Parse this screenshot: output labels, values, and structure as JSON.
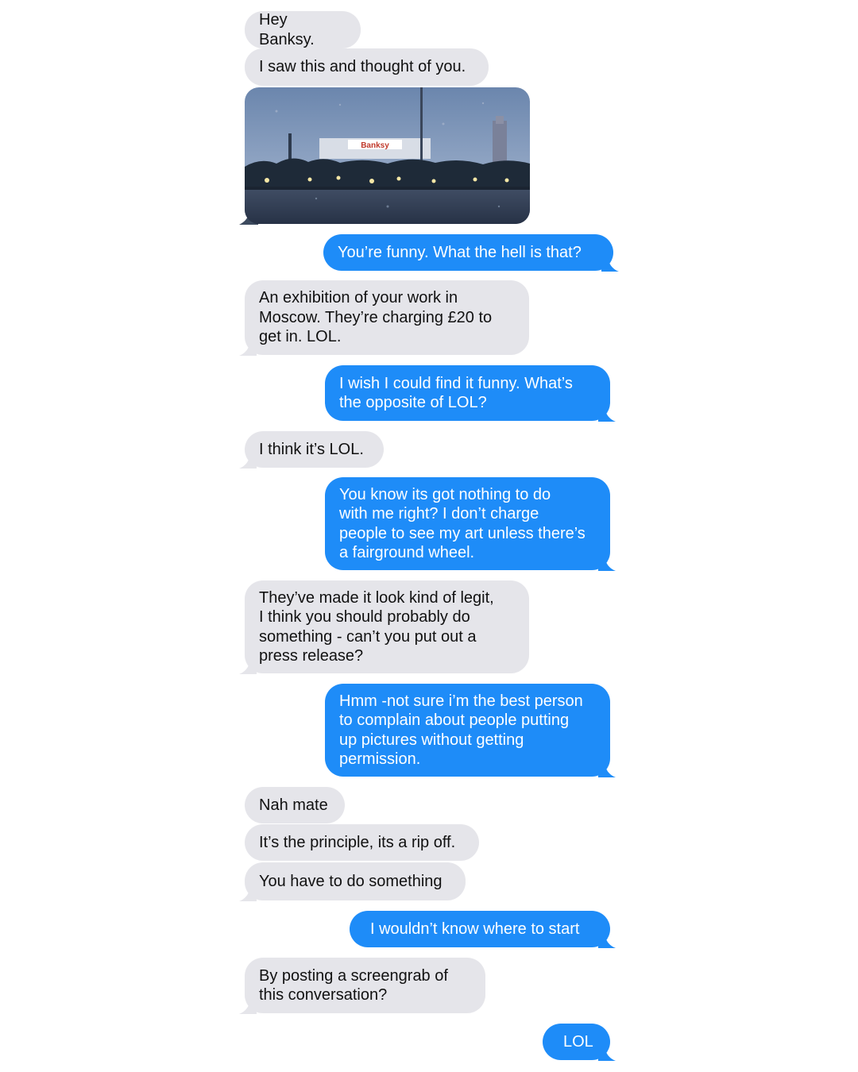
{
  "conversation": {
    "messages": [
      {
        "from": "them",
        "text": "Hey Banksy."
      },
      {
        "from": "them",
        "text": "I saw this and thought of you."
      },
      {
        "from": "them",
        "type": "image",
        "photo": {
          "sign_text": "Banksy",
          "description_icon": "photo-icon"
        }
      },
      {
        "from": "me",
        "text": "You’re funny. What the hell is that?"
      },
      {
        "from": "them",
        "text": "An exhibition of your work in\nMoscow. They’re charging £20 to\nget in. LOL."
      },
      {
        "from": "me",
        "text": "I wish I could find it funny. What’s\nthe opposite of LOL?"
      },
      {
        "from": "them",
        "text": "I think it’s LOL."
      },
      {
        "from": "me",
        "text": "You know its got nothing to do\nwith me right? I don’t charge\npeople to see my art unless there’s\na fairground wheel."
      },
      {
        "from": "them",
        "text": "They’ve made it look kind of legit,\nI think you should probably do\nsomething - can’t you put out a\npress release?"
      },
      {
        "from": "me",
        "text": "Hmm -not sure i’m the best person\nto complain about people putting\nup pictures without getting\npermission."
      },
      {
        "from": "them",
        "text": "Nah mate"
      },
      {
        "from": "them",
        "text": "It’s the principle, its a rip off."
      },
      {
        "from": "them",
        "text": "You have to do something"
      },
      {
        "from": "me",
        "text": "I wouldn’t know where to start"
      },
      {
        "from": "them",
        "text": "By posting a screengrab of\nthis conversation?"
      },
      {
        "from": "me",
        "text": "LOL"
      }
    ]
  },
  "colors": {
    "incoming_bubble": "#e5e5ea",
    "outgoing_bubble": "#1e8cf8",
    "incoming_text": "#111111",
    "outgoing_text": "#ffffff",
    "background": "#ffffff"
  }
}
